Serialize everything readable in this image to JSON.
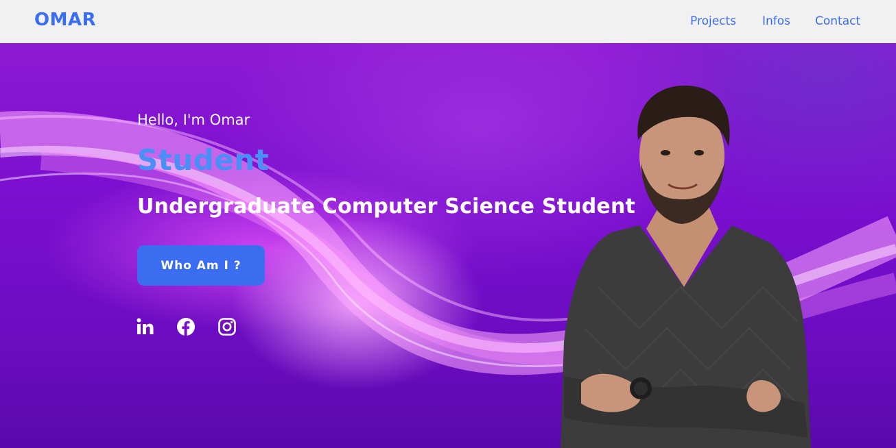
{
  "navbar": {
    "logo": "OMAR",
    "links": [
      {
        "label": "Projects"
      },
      {
        "label": "Infos"
      },
      {
        "label": "Contact"
      }
    ]
  },
  "hero": {
    "greeting": "Hello, I'm Omar",
    "role": "Student",
    "headline": "Undergraduate Computer Science Student",
    "cta_label": "Who Am I ?",
    "social_icons": [
      "linkedin-icon",
      "facebook-icon",
      "instagram-icon"
    ]
  },
  "colors": {
    "accent": "#3b6df0",
    "role_text": "#4a8ff5",
    "hero_purple": "#7a0fcf",
    "navbar_bg": "#f1f1f1"
  }
}
